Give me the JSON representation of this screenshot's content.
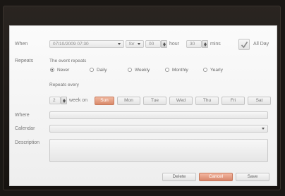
{
  "when": {
    "label": "When",
    "datetime": "07/10/2009 07:30",
    "for_label": "for",
    "hours": "00",
    "hour_label": "hour",
    "minutes": "30",
    "mins_label": "mins",
    "all_day_label": "All Day"
  },
  "repeats": {
    "label": "Repeats",
    "sub_label": "The event repeats",
    "options": [
      "Never",
      "Daily",
      "Weekly",
      "Monthly",
      "Yearly"
    ],
    "selected": "Never",
    "every_label": "Repeats every",
    "every_value": "2",
    "week_on_label": "week on",
    "days": [
      "Sun",
      "Mon",
      "Tue",
      "Wed",
      "Thu",
      "Fri",
      "Sat"
    ],
    "selected_day": "Sun"
  },
  "where": {
    "label": "Where",
    "value": ""
  },
  "calendar": {
    "label": "Calendar",
    "value": ""
  },
  "description": {
    "label": "Description",
    "value": ""
  },
  "buttons": {
    "delete": "Delete",
    "cancel": "Cancel",
    "save": "Save"
  },
  "colors": {
    "accent": "#d98a6a",
    "background": "#1a1714",
    "dialog": "#f5f5f5"
  },
  "icons": {
    "dropdown": "chevron-down-icon",
    "spinner": "spinner-icon",
    "all_day": "checkmark-icon"
  }
}
